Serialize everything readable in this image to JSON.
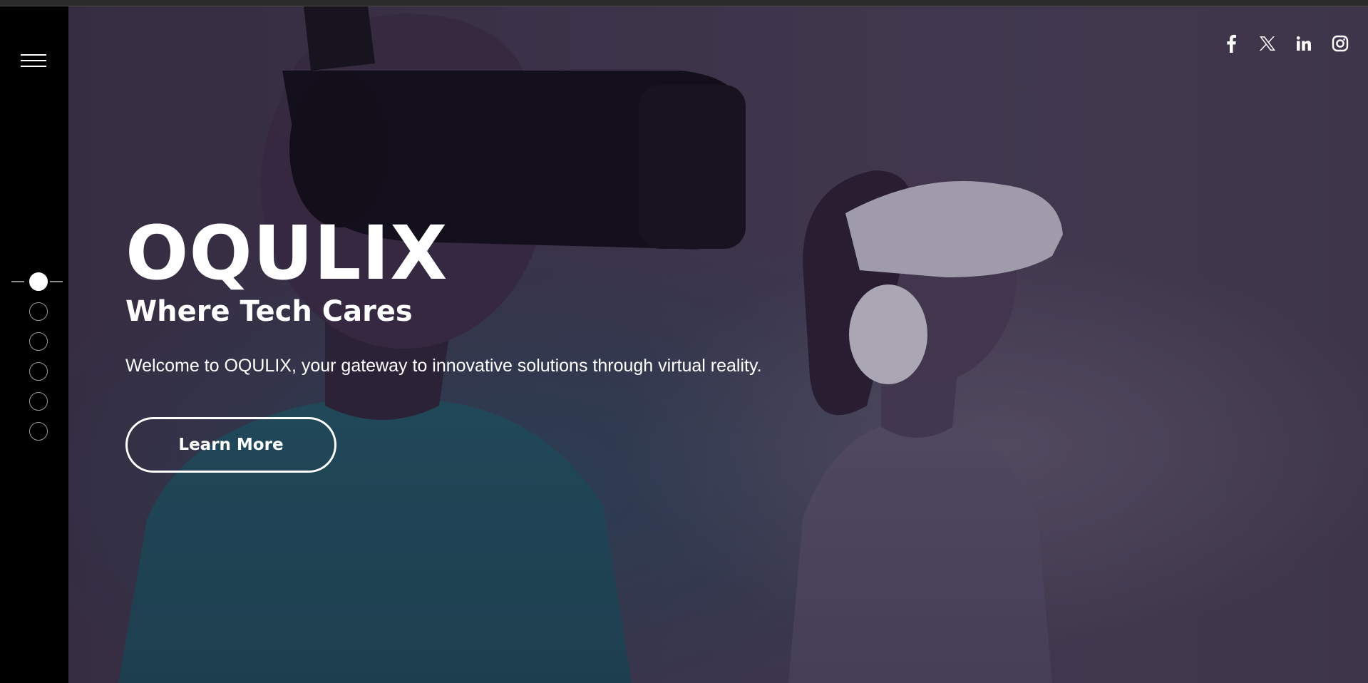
{
  "hero": {
    "brand": "OQULIX",
    "tagline": "Where Tech Cares",
    "welcome": "Welcome to OQULIX, your gateway to innovative solutions through virtual reality.",
    "cta_label": "Learn More"
  },
  "social": [
    {
      "icon": "facebook-icon"
    },
    {
      "icon": "x-twitter-icon"
    },
    {
      "icon": "linkedin-icon"
    },
    {
      "icon": "instagram-icon"
    }
  ],
  "slider": {
    "total_slides": 6,
    "active_slide": 1
  },
  "colors": {
    "sidebar": "#000000",
    "hero_tint": "#433a50",
    "text": "#ffffff"
  }
}
